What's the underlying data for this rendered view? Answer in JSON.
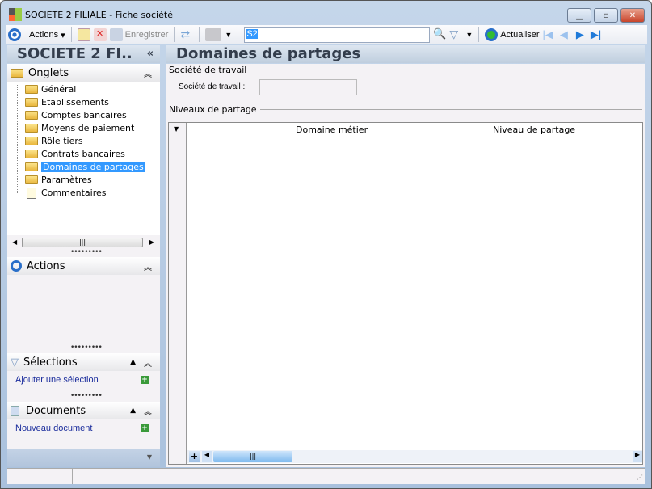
{
  "window": {
    "title": "SOCIETE 2 FILIALE -  Fiche société"
  },
  "toolbar": {
    "actions": "Actions",
    "save": "Enregistrer",
    "search_value": "S2",
    "refresh": "Actualiser"
  },
  "left_header": {
    "title": "SOCIETE 2 FI..",
    "collapse": "«"
  },
  "onglets": {
    "title": "Onglets",
    "items": [
      "Général",
      "Etablissements",
      "Comptes bancaires",
      "Moyens de paiement",
      "Rôle tiers",
      "Contrats bancaires",
      "Domaines de partages",
      "Paramètres",
      "Commentaires"
    ],
    "selected": "Domaines de partages"
  },
  "actions": {
    "title": "Actions"
  },
  "selections": {
    "title": "Sélections",
    "link": "Ajouter une sélection"
  },
  "documents": {
    "title": "Documents",
    "link": "Nouveau document"
  },
  "main": {
    "title": "Domaines de partages",
    "group1": "Société de travail",
    "field_label": "Société de travail :",
    "field_value": "",
    "group2": "Niveaux de partage",
    "columns": [
      "Domaine métier",
      "Niveau de partage"
    ]
  }
}
